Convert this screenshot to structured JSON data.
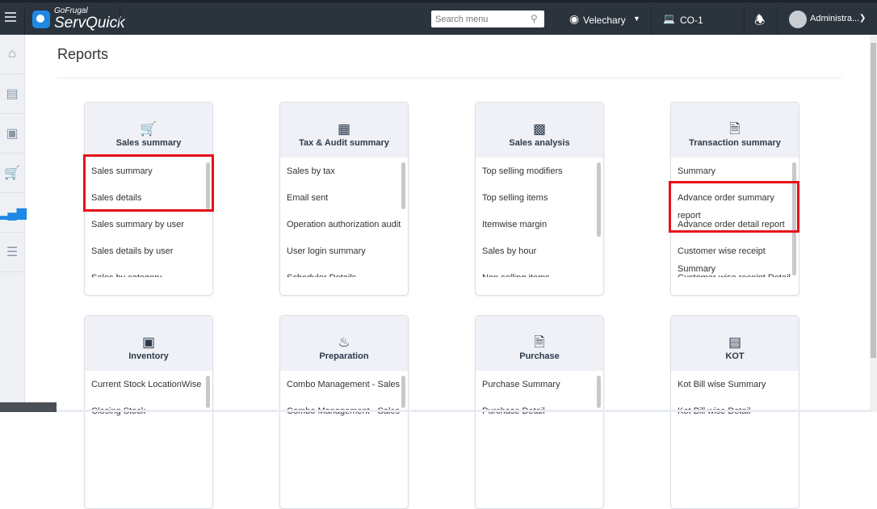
{
  "header": {
    "brand_top": "GoFrugal",
    "brand_name": "ServQuick",
    "search_placeholder": "Search menu",
    "location": "Velechary",
    "counter": "CO-1",
    "user": "Administra..."
  },
  "sidebar": {
    "items": [
      "home-icon",
      "catalog-icon",
      "inventory-icon",
      "cart-icon",
      "reports-icon",
      "settings-icon"
    ]
  },
  "page": {
    "title": "Reports"
  },
  "cards": [
    {
      "title": "Sales summary",
      "icon": "cart-icon",
      "items": [
        "Sales summary",
        "Sales details",
        "Sales summary by user",
        "Sales details by user",
        "Sales by category"
      ]
    },
    {
      "title": "Tax & Audit summary",
      "icon": "calculator-icon",
      "items": [
        "Sales by tax",
        "Email sent",
        "Operation authorization audit",
        "User login summary",
        "Scheduler Details"
      ]
    },
    {
      "title": "Sales analysis",
      "icon": "bar-chart-icon",
      "items": [
        "Top selling modifiers",
        "Top selling items",
        "Itemwise margin",
        "Sales by hour",
        "Non selling items"
      ]
    },
    {
      "title": "Transaction summary",
      "icon": "document-icon",
      "items": [
        "Summary",
        "Advance order summary report",
        "Advance order detail report",
        "Customer wise receipt Summary",
        "Customer wise receipt Detail"
      ]
    },
    {
      "title": "Inventory",
      "icon": "hand-truck-icon",
      "items": [
        "Current Stock LocationWise",
        "Closing Stock"
      ]
    },
    {
      "title": "Preparation",
      "icon": "cooking-pan-icon",
      "items": [
        "Combo Management - Sales",
        "Combo Management - Sales"
      ]
    },
    {
      "title": "Purchase",
      "icon": "purchase-icon",
      "items": [
        "Purchase Summary",
        "Purchase Detail"
      ]
    },
    {
      "title": "KOT",
      "icon": "receipt-icon",
      "items": [
        "Kot Bill wise Summary",
        "Kot Bill wise Detail"
      ]
    }
  ]
}
